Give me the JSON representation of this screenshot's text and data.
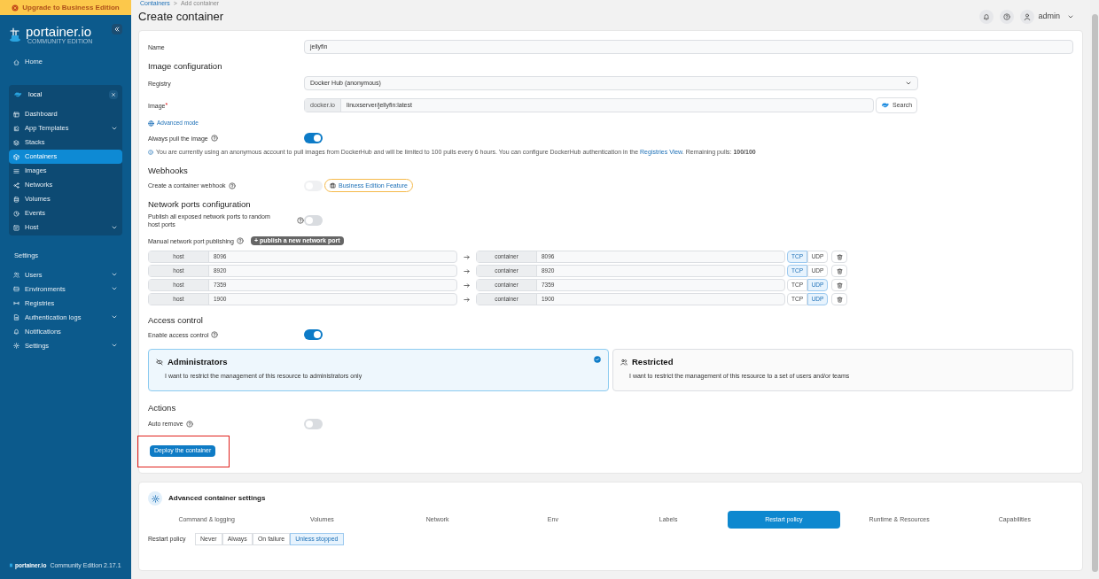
{
  "upgrade_banner": "Upgrade to Business Edition",
  "logo": {
    "name": "portainer.io",
    "edition": "COMMUNITY EDITION"
  },
  "sidebar": {
    "home": "Home",
    "environment": {
      "name": "local",
      "items": [
        {
          "label": "Dashboard",
          "selected": false,
          "expandable": false
        },
        {
          "label": "App Templates",
          "selected": false,
          "expandable": true
        },
        {
          "label": "Stacks",
          "selected": false,
          "expandable": false
        },
        {
          "label": "Containers",
          "selected": true,
          "expandable": false
        },
        {
          "label": "Images",
          "selected": false,
          "expandable": false
        },
        {
          "label": "Networks",
          "selected": false,
          "expandable": false
        },
        {
          "label": "Volumes",
          "selected": false,
          "expandable": false
        },
        {
          "label": "Events",
          "selected": false,
          "expandable": false
        },
        {
          "label": "Host",
          "selected": false,
          "expandable": true
        }
      ]
    },
    "settings_title": "Settings",
    "settings_items": [
      {
        "label": "Users",
        "expandable": true
      },
      {
        "label": "Environments",
        "expandable": true
      },
      {
        "label": "Registries",
        "expandable": false
      },
      {
        "label": "Authentication logs",
        "expandable": true
      },
      {
        "label": "Notifications",
        "expandable": false
      },
      {
        "label": "Settings",
        "expandable": true
      }
    ]
  },
  "footer": {
    "brand": "portainer.io",
    "version": "Community Edition 2.17.1"
  },
  "breadcrumb": [
    "Containers",
    "Add container"
  ],
  "breadcrumb_separator": ">",
  "title": "Create container",
  "user": "admin",
  "form": {
    "name_label": "Name",
    "name_value": "jellyfin",
    "image_heading": "Image configuration",
    "registry_label": "Registry",
    "registry_value": "Docker Hub (anonymous)",
    "image_label": "Image",
    "image_required_mark": "*",
    "image_prefix": "docker.io",
    "image_value": "linuxserver/jellyfin:latest",
    "search_button": "Search",
    "advanced_mode": "Advanced mode",
    "always_pull": {
      "label": "Always pull the image",
      "on": true
    },
    "info": {
      "text": "You are currently using an anonymous account to pull images from DockerHub and will be limited to 100 pulls every 6 hours. You can configure DockerHub authentication in the",
      "link": "Registries View",
      "rest": ". Remaining pulls: **100/100**"
    },
    "webhooks_heading": "Webhooks",
    "webhook": {
      "label": "Create a container webhook",
      "on": false,
      "badge": "Business Edition Feature"
    },
    "network_heading": "Network ports configuration",
    "publish_all": {
      "label": "Publish all exposed network ports to random host ports",
      "on": false
    },
    "manual_label": "Manual network port publishing",
    "add_port_button": "+ publish a new network port",
    "ports": [
      {
        "host_label": "host",
        "host": "8096",
        "container_label": "container",
        "container": "8096",
        "protocols": [
          {
            "label": "TCP",
            "selected": true
          },
          {
            "label": "UDP",
            "selected": false
          }
        ]
      },
      {
        "host_label": "host",
        "host": "8920",
        "container_label": "container",
        "container": "8920",
        "protocols": [
          {
            "label": "TCP",
            "selected": true
          },
          {
            "label": "UDP",
            "selected": false
          }
        ]
      },
      {
        "host_label": "host",
        "host": "7359",
        "container_label": "container",
        "container": "7359",
        "protocols": [
          {
            "label": "TCP",
            "selected": false
          },
          {
            "label": "UDP",
            "selected": true
          }
        ]
      },
      {
        "host_label": "host",
        "host": "1900",
        "container_label": "container",
        "container": "1900",
        "protocols": [
          {
            "label": "TCP",
            "selected": false
          },
          {
            "label": "UDP",
            "selected": true
          }
        ]
      }
    ],
    "access_heading": "Access control",
    "access_toggle": {
      "label": "Enable access control",
      "on": true
    },
    "access_options": [
      {
        "title": "Administrators",
        "description": "I want to restrict the management of this resource to administrators only",
        "selected": true
      },
      {
        "title": "Restricted",
        "description": "I want to restrict the management of this resource to a set of users and/or teams",
        "selected": false
      }
    ],
    "actions_heading": "Actions",
    "auto_remove": {
      "label": "Auto remove",
      "on": false
    },
    "deploy_button": "Deploy the container"
  },
  "advanced": {
    "title": "Advanced container settings",
    "tabs": [
      {
        "label": "Command & logging",
        "selected": false
      },
      {
        "label": "Volumes",
        "selected": false
      },
      {
        "label": "Network",
        "selected": false
      },
      {
        "label": "Env",
        "selected": false
      },
      {
        "label": "Labels",
        "selected": false
      },
      {
        "label": "Restart policy",
        "selected": true
      },
      {
        "label": "Runtime & Resources",
        "selected": false
      },
      {
        "label": "Capabilities",
        "selected": false
      }
    ],
    "restart_label": "Restart policy",
    "restart_options": [
      {
        "label": "Never",
        "selected": false
      },
      {
        "label": "Always",
        "selected": false
      },
      {
        "label": "On failure",
        "selected": false
      },
      {
        "label": "Unless stopped",
        "selected": true
      }
    ]
  }
}
